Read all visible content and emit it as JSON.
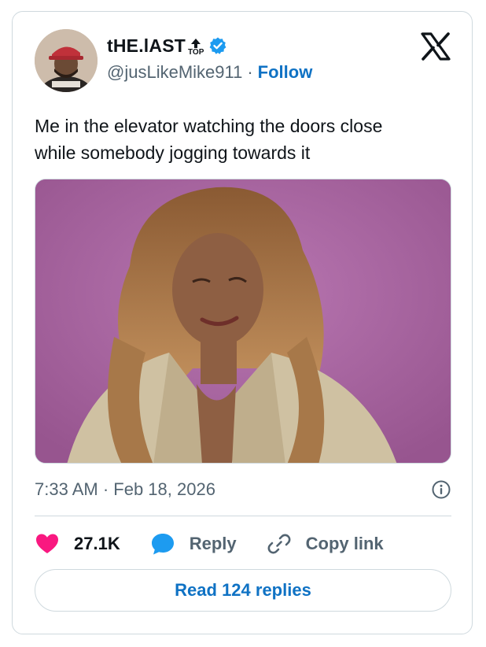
{
  "tweet": {
    "author": {
      "display_name": "tHE.lAST",
      "badge_label": "TOP",
      "handle": "@jusLikeMike911",
      "separator": "·",
      "follow_label": "Follow",
      "verified": true
    },
    "text_line1": "Me in the elevator watching the doors close",
    "text_line2": "while somebody jogging towards it",
    "timestamp": "7:33 AM · Feb 18, 2026",
    "actions": {
      "likes": "27.1K",
      "reply_label": "Reply",
      "copy_link_label": "Copy link"
    },
    "read_replies_label": "Read 124 replies"
  },
  "colors": {
    "accent_blue": "#0f72c4",
    "like_red": "#f91880",
    "reply_blue": "#1d9bf0",
    "muted_text": "#536471",
    "border": "#cfd9de"
  },
  "icons": [
    "x-logo-icon",
    "verified-badge-icon",
    "top-arrow-icon",
    "info-icon",
    "heart-icon",
    "reply-bubble-icon",
    "link-icon"
  ]
}
